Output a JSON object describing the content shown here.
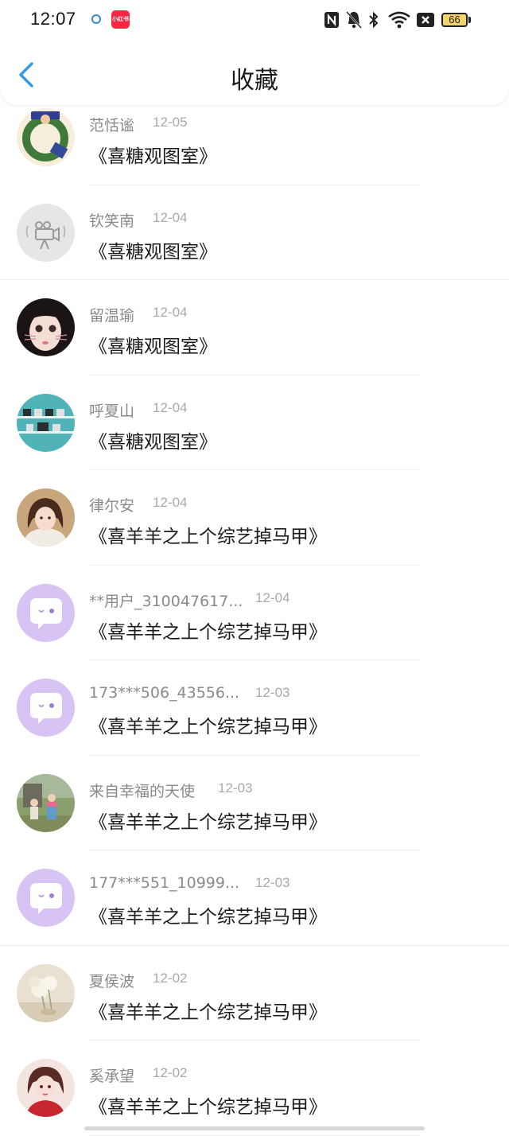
{
  "status": {
    "time": "12:07",
    "app_badge": "小红书",
    "battery": "66",
    "colors": {
      "battery": "#f3d36b",
      "app_badge": "#ff2442"
    }
  },
  "header": {
    "title": "收藏",
    "back_icon": "chevron-left-icon",
    "accent": "#2f9be8"
  },
  "items": [
    {
      "username": "范恬谧",
      "date": "12-05",
      "title": "《喜糖观图室》",
      "avatar": "astronaut-wreath-avatar"
    },
    {
      "username": "钦笑南",
      "date": "12-04",
      "title": "《喜糖观图室》",
      "avatar": "default-camera-avatar"
    },
    {
      "username": "留温瑜",
      "date": "12-04",
      "title": "《喜糖观图室》",
      "avatar": "cat-whisker-girl-avatar"
    },
    {
      "username": "呼夏山",
      "date": "12-04",
      "title": "《喜糖观图室》",
      "avatar": "camera-shelf-avatar"
    },
    {
      "username": "律尔安",
      "date": "12-04",
      "title": "《喜羊羊之上个综艺掉马甲》",
      "avatar": "girl-photo-avatar"
    },
    {
      "username": "**用户_310047617...",
      "date": "12-04",
      "title": "《喜羊羊之上个综艺掉马甲》",
      "avatar": "purple-chat-bubble-avatar"
    },
    {
      "username": "173***506_43556...",
      "date": "12-03",
      "title": "《喜羊羊之上个综艺掉马甲》",
      "avatar": "purple-chat-bubble-avatar"
    },
    {
      "username": "来自幸福的天使",
      "date": "12-03",
      "title": "《喜羊羊之上个综艺掉马甲》",
      "avatar": "kids-outdoor-avatar"
    },
    {
      "username": "177***551_10999...",
      "date": "12-03",
      "title": "《喜羊羊之上个综艺掉马甲》",
      "avatar": "purple-chat-bubble-avatar"
    },
    {
      "username": "夏侯波",
      "date": "12-02",
      "title": "《喜羊羊之上个综艺掉马甲》",
      "avatar": "flower-still-life-avatar"
    },
    {
      "username": "奚承望",
      "date": "12-02",
      "title": "《喜羊羊之上个综艺掉马甲》",
      "avatar": "anime-red-girl-avatar"
    }
  ]
}
